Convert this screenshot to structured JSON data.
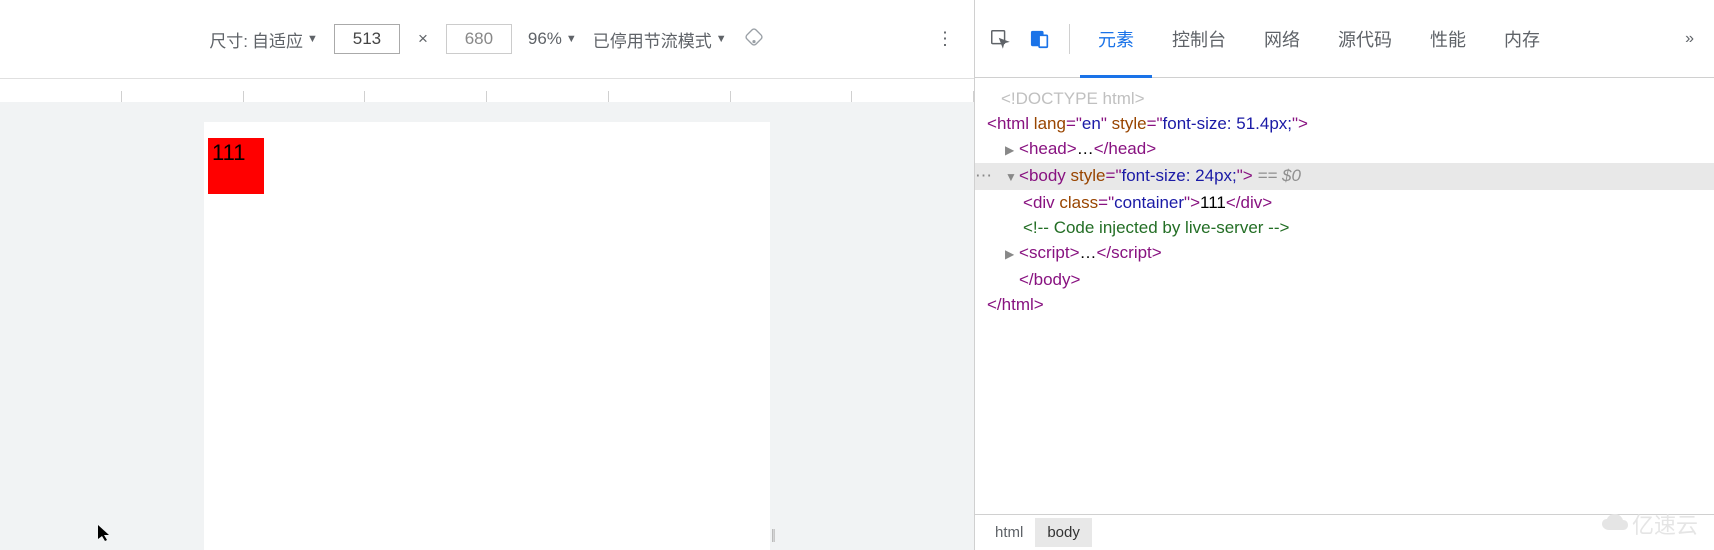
{
  "device_toolbar": {
    "size_label": "尺寸:",
    "size_mode": "自适应",
    "width": "513",
    "height": "680",
    "zoom": "96%",
    "throttle": "已停用节流模式"
  },
  "viewport": {
    "box_text": "111"
  },
  "devtools": {
    "tabs": [
      "元素",
      "控制台",
      "网络",
      "源代码",
      "性能",
      "内存"
    ],
    "active_tab": "元素"
  },
  "dom": {
    "doctype": "<!DOCTYPE html>",
    "html_open_tag": "html",
    "html_open_attrs": [
      {
        "name": "lang",
        "value": "en"
      },
      {
        "name": "style",
        "value": "font-size: 51.4px;"
      }
    ],
    "head_tag": "head",
    "head_ellipsis": "…",
    "body_tag": "body",
    "body_attrs": [
      {
        "name": "style",
        "value": "font-size: 24px;"
      }
    ],
    "body_selected_marker": " == $0",
    "div_tag": "div",
    "div_attrs": [
      {
        "name": "class",
        "value": "container"
      }
    ],
    "div_text": "111",
    "comment": "<!-- Code injected by live-server -->",
    "script_tag": "script",
    "script_ellipsis": "…",
    "close_body": "</body>",
    "close_html": "</html>"
  },
  "breadcrumb": [
    "html",
    "body"
  ],
  "watermark": "亿速云"
}
